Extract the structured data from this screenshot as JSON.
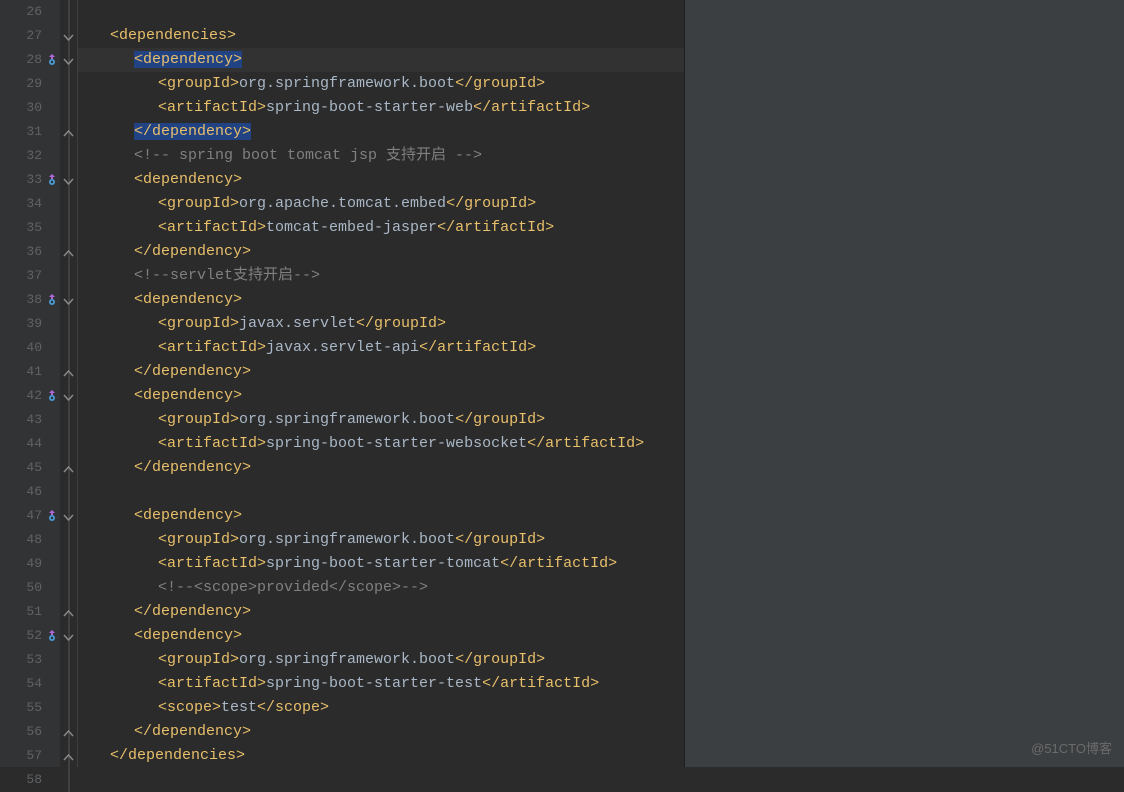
{
  "watermark": "@51CTO博客",
  "lines": [
    {
      "n": 26,
      "fold": "line",
      "marker": false
    },
    {
      "n": 27,
      "fold": "open",
      "marker": false,
      "indent": 1,
      "tokens": [
        {
          "t": "tag",
          "v": "<dependencies>"
        }
      ]
    },
    {
      "n": 28,
      "fold": "open",
      "marker": true,
      "hl": true,
      "indent": 2,
      "tokens": [
        {
          "t": "tag",
          "v": "<dependency>",
          "sel": true
        }
      ]
    },
    {
      "n": 29,
      "fold": "line",
      "marker": false,
      "indent": 3,
      "tokens": [
        {
          "t": "tag",
          "v": "<groupId>"
        },
        {
          "t": "txt",
          "v": "org.springframework.boot"
        },
        {
          "t": "tag",
          "v": "</groupId>"
        }
      ]
    },
    {
      "n": 30,
      "fold": "line",
      "marker": false,
      "indent": 3,
      "tokens": [
        {
          "t": "tag",
          "v": "<artifactId>"
        },
        {
          "t": "txt",
          "v": "spring-boot-starter-web"
        },
        {
          "t": "tag",
          "v": "</artifactId>"
        }
      ]
    },
    {
      "n": 31,
      "fold": "close",
      "marker": false,
      "indent": 2,
      "tokens": [
        {
          "t": "tag",
          "v": "</dependency>",
          "sel": true
        }
      ]
    },
    {
      "n": 32,
      "fold": "line",
      "marker": false,
      "indent": 2,
      "tokens": [
        {
          "t": "cmt",
          "v": "<!-- spring boot tomcat jsp 支持开启 -->"
        }
      ]
    },
    {
      "n": 33,
      "fold": "open",
      "marker": true,
      "indent": 2,
      "tokens": [
        {
          "t": "tag",
          "v": "<dependency>"
        }
      ]
    },
    {
      "n": 34,
      "fold": "line",
      "marker": false,
      "indent": 3,
      "tokens": [
        {
          "t": "tag",
          "v": "<groupId>"
        },
        {
          "t": "txt",
          "v": "org.apache.tomcat.embed"
        },
        {
          "t": "tag",
          "v": "</groupId>"
        }
      ]
    },
    {
      "n": 35,
      "fold": "line",
      "marker": false,
      "indent": 3,
      "tokens": [
        {
          "t": "tag",
          "v": "<artifactId>"
        },
        {
          "t": "txt",
          "v": "tomcat-embed-jasper"
        },
        {
          "t": "tag",
          "v": "</artifactId>"
        }
      ]
    },
    {
      "n": 36,
      "fold": "close",
      "marker": false,
      "indent": 2,
      "tokens": [
        {
          "t": "tag",
          "v": "</dependency>"
        }
      ]
    },
    {
      "n": 37,
      "fold": "line",
      "marker": false,
      "indent": 2,
      "tokens": [
        {
          "t": "cmt",
          "v": "<!--servlet支持开启-->"
        }
      ]
    },
    {
      "n": 38,
      "fold": "open",
      "marker": true,
      "indent": 2,
      "tokens": [
        {
          "t": "tag",
          "v": "<dependency>"
        }
      ]
    },
    {
      "n": 39,
      "fold": "line",
      "marker": false,
      "indent": 3,
      "tokens": [
        {
          "t": "tag",
          "v": "<groupId>"
        },
        {
          "t": "txt",
          "v": "javax.servlet"
        },
        {
          "t": "tag",
          "v": "</groupId>"
        }
      ]
    },
    {
      "n": 40,
      "fold": "line",
      "marker": false,
      "indent": 3,
      "tokens": [
        {
          "t": "tag",
          "v": "<artifactId>"
        },
        {
          "t": "txt",
          "v": "javax.servlet-api"
        },
        {
          "t": "tag",
          "v": "</artifactId>"
        }
      ]
    },
    {
      "n": 41,
      "fold": "close",
      "marker": false,
      "indent": 2,
      "tokens": [
        {
          "t": "tag",
          "v": "</dependency>"
        }
      ]
    },
    {
      "n": 42,
      "fold": "open",
      "marker": true,
      "indent": 2,
      "tokens": [
        {
          "t": "tag",
          "v": "<dependency>"
        }
      ]
    },
    {
      "n": 43,
      "fold": "line",
      "marker": false,
      "indent": 3,
      "tokens": [
        {
          "t": "tag",
          "v": "<groupId>"
        },
        {
          "t": "txt",
          "v": "org.springframework.boot"
        },
        {
          "t": "tag",
          "v": "</groupId>"
        }
      ]
    },
    {
      "n": 44,
      "fold": "line",
      "marker": false,
      "indent": 3,
      "tokens": [
        {
          "t": "tag",
          "v": "<artifactId>"
        },
        {
          "t": "txt",
          "v": "spring-boot-starter-websocket"
        },
        {
          "t": "tag",
          "v": "</artifactId>"
        }
      ]
    },
    {
      "n": 45,
      "fold": "close",
      "marker": false,
      "indent": 2,
      "tokens": [
        {
          "t": "tag",
          "v": "</dependency>"
        }
      ]
    },
    {
      "n": 46,
      "fold": "line",
      "marker": false,
      "indent": 0,
      "tokens": []
    },
    {
      "n": 47,
      "fold": "open",
      "marker": true,
      "indent": 2,
      "tokens": [
        {
          "t": "tag",
          "v": "<dependency>"
        }
      ]
    },
    {
      "n": 48,
      "fold": "line",
      "marker": false,
      "indent": 3,
      "tokens": [
        {
          "t": "tag",
          "v": "<groupId>"
        },
        {
          "t": "txt",
          "v": "org.springframework.boot"
        },
        {
          "t": "tag",
          "v": "</groupId>"
        }
      ]
    },
    {
      "n": 49,
      "fold": "line",
      "marker": false,
      "indent": 3,
      "tokens": [
        {
          "t": "tag",
          "v": "<artifactId>"
        },
        {
          "t": "txt",
          "v": "spring-boot-starter-tomcat"
        },
        {
          "t": "tag",
          "v": "</artifactId>"
        }
      ]
    },
    {
      "n": 50,
      "fold": "line",
      "marker": false,
      "indent": 3,
      "tokens": [
        {
          "t": "cmt",
          "v": "<!--<scope>provided</scope>-->"
        }
      ]
    },
    {
      "n": 51,
      "fold": "close",
      "marker": false,
      "indent": 2,
      "tokens": [
        {
          "t": "tag",
          "v": "</dependency>"
        }
      ]
    },
    {
      "n": 52,
      "fold": "open",
      "marker": true,
      "indent": 2,
      "tokens": [
        {
          "t": "tag",
          "v": "<dependency>"
        }
      ]
    },
    {
      "n": 53,
      "fold": "line",
      "marker": false,
      "indent": 3,
      "tokens": [
        {
          "t": "tag",
          "v": "<groupId>"
        },
        {
          "t": "txt",
          "v": "org.springframework.boot"
        },
        {
          "t": "tag",
          "v": "</groupId>"
        }
      ]
    },
    {
      "n": 54,
      "fold": "line",
      "marker": false,
      "indent": 3,
      "tokens": [
        {
          "t": "tag",
          "v": "<artifactId>"
        },
        {
          "t": "txt",
          "v": "spring-boot-starter-test"
        },
        {
          "t": "tag",
          "v": "</artifactId>"
        }
      ]
    },
    {
      "n": 55,
      "fold": "line",
      "marker": false,
      "indent": 3,
      "tokens": [
        {
          "t": "tag",
          "v": "<scope>"
        },
        {
          "t": "txt",
          "v": "test"
        },
        {
          "t": "tag",
          "v": "</scope>"
        }
      ]
    },
    {
      "n": 56,
      "fold": "close",
      "marker": false,
      "indent": 2,
      "tokens": [
        {
          "t": "tag",
          "v": "</dependency>"
        }
      ]
    },
    {
      "n": 57,
      "fold": "close",
      "marker": false,
      "indent": 1,
      "tokens": [
        {
          "t": "tag",
          "v": "</dependencies>"
        }
      ]
    },
    {
      "n": 58,
      "fold": "line",
      "marker": false
    }
  ]
}
